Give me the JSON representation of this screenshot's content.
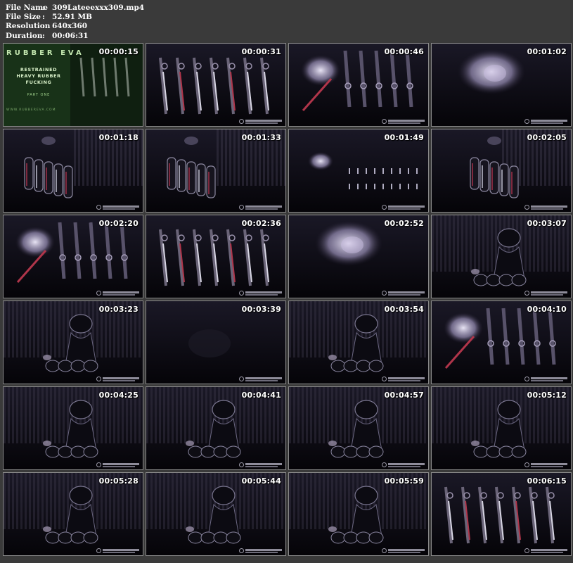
{
  "info": {
    "rows": [
      {
        "label": "File Name",
        "sep": ":",
        "value": "309Lateeexxx309.mp4"
      },
      {
        "label": "File Size",
        "sep": ":",
        "value": "52.91 MB"
      },
      {
        "label": "Resolution",
        "sep": ":",
        "value": "640x360"
      },
      {
        "label": "Duration",
        "sep": ":",
        "value": "00:06:31"
      }
    ]
  },
  "thumbnails": [
    {
      "time": "00:00:15",
      "scene": "title"
    },
    {
      "time": "00:00:31",
      "scene": "straps"
    },
    {
      "time": "00:00:46",
      "scene": "face-straps"
    },
    {
      "time": "00:01:02",
      "scene": "face-glow"
    },
    {
      "time": "00:01:18",
      "scene": "body-left"
    },
    {
      "time": "00:01:33",
      "scene": "body-left"
    },
    {
      "time": "00:01:49",
      "scene": "lights"
    },
    {
      "time": "00:02:05",
      "scene": "body-right"
    },
    {
      "time": "00:02:20",
      "scene": "face-straps"
    },
    {
      "time": "00:02:36",
      "scene": "straps"
    },
    {
      "time": "00:02:52",
      "scene": "face-glow"
    },
    {
      "time": "00:03:07",
      "scene": "figure-curtain"
    },
    {
      "time": "00:03:23",
      "scene": "figure-curtain"
    },
    {
      "time": "00:03:39",
      "scene": "dark"
    },
    {
      "time": "00:03:54",
      "scene": "figure-curtain"
    },
    {
      "time": "00:04:10",
      "scene": "face-straps"
    },
    {
      "time": "00:04:25",
      "scene": "figure-curtain"
    },
    {
      "time": "00:04:41",
      "scene": "figure-curtain"
    },
    {
      "time": "00:04:57",
      "scene": "figure-curtain"
    },
    {
      "time": "00:05:12",
      "scene": "figure-curtain"
    },
    {
      "time": "00:05:28",
      "scene": "figure-curtain"
    },
    {
      "time": "00:05:44",
      "scene": "figure-curtain"
    },
    {
      "time": "00:05:59",
      "scene": "figure-curtain"
    },
    {
      "time": "00:06:15",
      "scene": "straps"
    }
  ],
  "title_card": {
    "brand": "RUBBER EVA",
    "lines": [
      "RESTRAINED",
      "HEAVY RUBBER",
      "FUCKING"
    ],
    "part": "PART ONE",
    "site": "WWW.RUBBEREVA.COM"
  },
  "colors": {
    "page_bg": "#3a3a3a",
    "thumb_border": "#8a8a8a",
    "title_bg": "#1c3a1c",
    "title_text": "#9fd08a"
  }
}
